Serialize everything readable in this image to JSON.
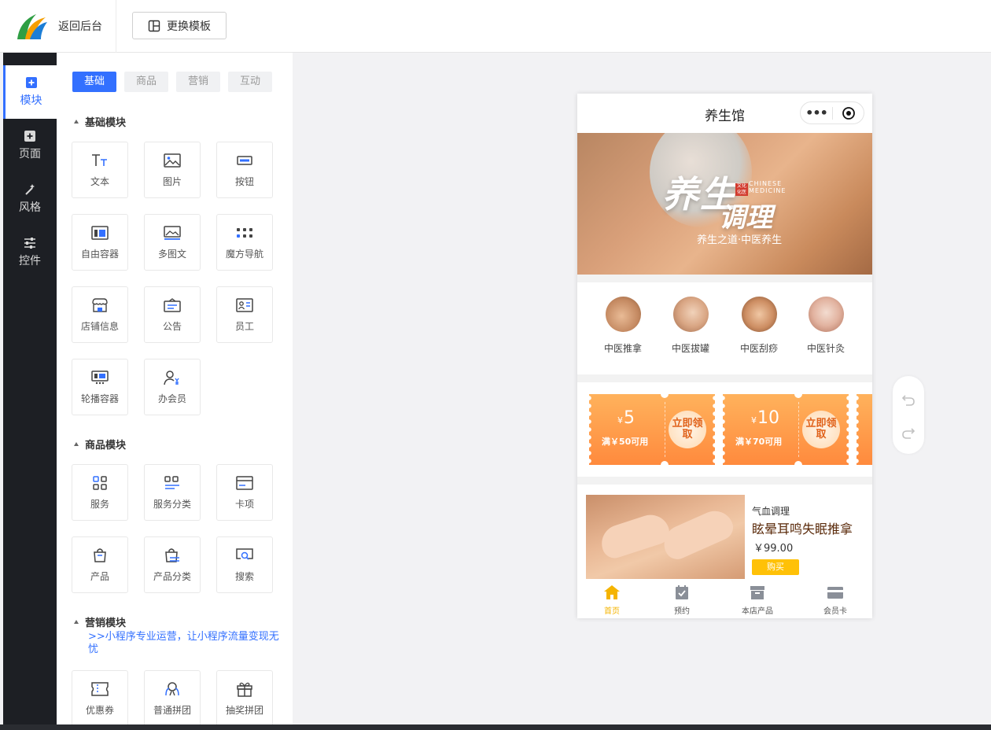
{
  "topbar": {
    "back_label": "返回后台",
    "template_button_label": "更换模板"
  },
  "leftnav": {
    "items": [
      {
        "label": "模块",
        "active": true
      },
      {
        "label": "页面",
        "active": false
      },
      {
        "label": "风格",
        "active": false
      },
      {
        "label": "控件",
        "active": false
      }
    ]
  },
  "panel": {
    "tabs": [
      {
        "label": "基础",
        "active": true
      },
      {
        "label": "商品",
        "active": false
      },
      {
        "label": "营销",
        "active": false
      },
      {
        "label": "互动",
        "active": false
      }
    ],
    "sections": {
      "basic": {
        "title": "基础模块",
        "items": [
          "文本",
          "图片",
          "按钮",
          "自由容器",
          "多图文",
          "魔方导航",
          "店铺信息",
          "公告",
          "员工",
          "轮播容器",
          "办会员"
        ]
      },
      "goods": {
        "title": "商品模块",
        "items": [
          "服务",
          "服务分类",
          "卡项",
          "产品",
          "产品分类",
          "搜索"
        ]
      },
      "marketing": {
        "title": "营销模块",
        "note": ">>小程序专业运营，让小程序流量变现无忧",
        "items": [
          "优惠券",
          "普通拼团",
          "抽奖拼团"
        ]
      }
    }
  },
  "phone": {
    "title": "养生馆",
    "banner": {
      "title_part1": "养生",
      "title_part2": "调理",
      "seal_text": "文化 化医",
      "english": "CHINESE MEDICINE",
      "subtitle": "养生之道·中医养生"
    },
    "categories": [
      "中医推拿",
      "中医拔罐",
      "中医刮痧",
      "中医针灸"
    ],
    "coupons": [
      {
        "currency": "¥",
        "amount": "5",
        "condition": "满￥50可用",
        "claim": "立即领取"
      },
      {
        "currency": "¥",
        "amount": "10",
        "condition": "满￥70可用",
        "claim": "立即领取"
      }
    ],
    "product": {
      "tag": "气血调理",
      "name": "眩晕耳鸣失眠推拿",
      "price": "￥99.00",
      "buy_label": "购买"
    },
    "tabbar": [
      {
        "label": "首页",
        "icon": "home-icon",
        "active": true
      },
      {
        "label": "预约",
        "icon": "calendar-check-icon",
        "active": false
      },
      {
        "label": "本店产品",
        "icon": "box-icon",
        "active": false
      },
      {
        "label": "会员卡",
        "icon": "card-icon",
        "active": false
      }
    ]
  },
  "colors": {
    "accent": "#3370ff",
    "nav_bg": "#1d1f24",
    "coupon_orange": "#ff8a3d",
    "buy_yellow": "#ffc107",
    "tab_active": "#f5b400"
  }
}
